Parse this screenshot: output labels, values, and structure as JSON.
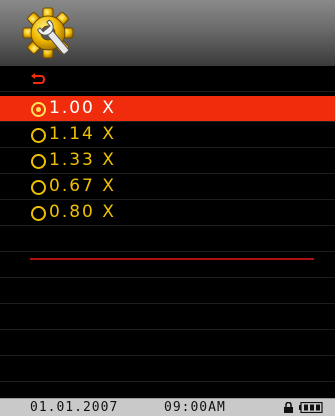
{
  "header": {
    "icon": "gear-wrench-icon",
    "accent": "#f0c000"
  },
  "back": {
    "icon": "back-arrow-icon",
    "color": "#f02c0c"
  },
  "options": [
    {
      "label": "1.00 X",
      "selected": true
    },
    {
      "label": "1.14 X",
      "selected": false
    },
    {
      "label": "1.33 X",
      "selected": false
    },
    {
      "label": "0.67 X",
      "selected": false
    },
    {
      "label": "0.80 X",
      "selected": false
    }
  ],
  "colors": {
    "highlight": "#f02c0c",
    "text": "#f0c000",
    "selected_text": "#ffffff",
    "divider": "#b01010"
  },
  "status_bar": {
    "date": "01.01.2007",
    "time": "09:00AM",
    "lock_icon": "lock-icon",
    "battery_icon": "battery-icon"
  }
}
